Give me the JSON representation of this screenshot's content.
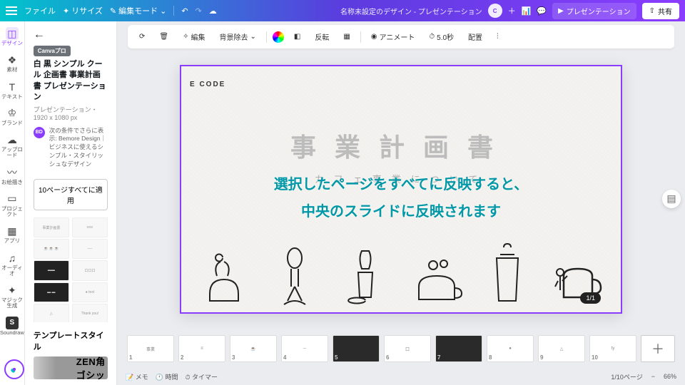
{
  "topbar": {
    "file": "ファイル",
    "resize": "リサイズ",
    "edit_mode": "編集モード",
    "doc_title": "名称未設定のデザイン - プレゼンテーション",
    "present": "プレゼンテーション",
    "share": "共有"
  },
  "rail": {
    "design": "デザイン",
    "elements": "素材",
    "text": "テキスト",
    "brand": "ブランド",
    "upload": "アップロード",
    "draw": "お絵描き",
    "project": "プロジェクト",
    "apps": "アプリ",
    "audio": "オーディオ",
    "magic": "マジック生成",
    "soundraw": "Soundraw"
  },
  "panel": {
    "pro_badge": "Canvaプロ",
    "title": "白 黒 シンプル クール 企画書 事業計画書 プレゼンテーション",
    "meta": "プレゼンテーション・1920 x 1080 px",
    "suggest_badge": "BD",
    "suggest": "次の条件でさらに表示: Bemore Design｜ビジネスに使えるシンプル・スタイリッシュなデザイン",
    "apply_all": "10ページすべてに適用",
    "style_header": "テンプレートスタイル",
    "font_preview": "ZEN角ゴシッ"
  },
  "toolbar": {
    "edit_img": "編集",
    "bg_remove": "背景除去",
    "flip": "反転",
    "animate": "アニメート",
    "duration": "5.0秒",
    "position": "配置"
  },
  "slide": {
    "code": "E CODE",
    "big": "事業計画書",
    "sub": "カフェ事業について",
    "page_pill": "1/1"
  },
  "overlay": {
    "line1": "選択したページをすべてに反映すると、",
    "line2": "中央のスライドに反映されます"
  },
  "status": {
    "notes": "メモ",
    "time": "時間",
    "timer": "タイマー",
    "page_ind": "1/10ページ",
    "zoom": "66%"
  },
  "strip_count": 10
}
